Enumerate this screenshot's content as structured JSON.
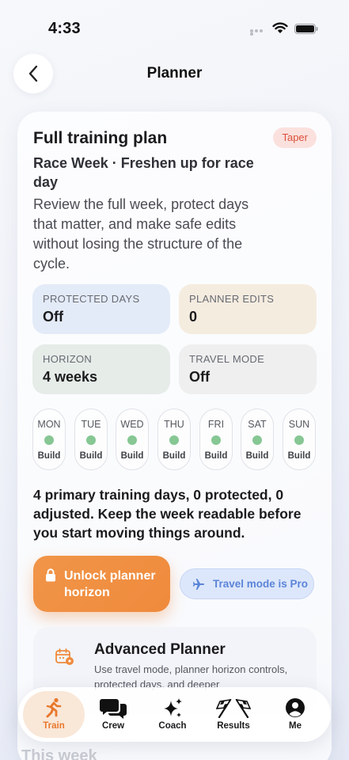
{
  "status_bar": {
    "time": "4:33"
  },
  "header": {
    "title": "Planner"
  },
  "plan": {
    "title": "Full training plan",
    "badge": "Taper",
    "subtitle": "Race Week · Freshen up for race day",
    "description": "Review the full week, protect days that matter, and make safe edits without losing the structure of the cycle."
  },
  "stats": [
    {
      "label": "PROTECTED DAYS",
      "value": "Off",
      "color": "#e4ebf8"
    },
    {
      "label": "PLANNER EDITS",
      "value": "0",
      "color": "#f5ece0"
    },
    {
      "label": "HORIZON",
      "value": "4 weeks",
      "color": "#e6ece8"
    },
    {
      "label": "TRAVEL MODE",
      "value": "Off",
      "color": "#efefef"
    }
  ],
  "days": [
    {
      "name": "MON",
      "tag": "Build"
    },
    {
      "name": "TUE",
      "tag": "Build"
    },
    {
      "name": "WED",
      "tag": "Build"
    },
    {
      "name": "THU",
      "tag": "Build"
    },
    {
      "name": "FRI",
      "tag": "Build"
    },
    {
      "name": "SAT",
      "tag": "Build"
    },
    {
      "name": "SUN",
      "tag": "Build"
    }
  ],
  "summary": "4 primary training days, 0 protected, 0 adjusted. Keep the week readable before you start moving things around.",
  "actions": {
    "unlock_label": "Unlock planner horizon",
    "travel_label": "Travel mode is Pro"
  },
  "advanced": {
    "title": "Advanced Planner",
    "description": "Use travel mode, planner horizon controls, protected days, and deeper"
  },
  "next_section": "This week",
  "tabs": [
    {
      "label": "Train",
      "icon": "runner-icon",
      "active": true
    },
    {
      "label": "Crew",
      "icon": "chat-bubbles-icon",
      "active": false
    },
    {
      "label": "Coach",
      "icon": "sparkles-icon",
      "active": false
    },
    {
      "label": "Results",
      "icon": "checkered-flags-icon",
      "active": false
    },
    {
      "label": "Me",
      "icon": "person-icon",
      "active": false
    }
  ],
  "colors": {
    "accent": "#ef8a3c",
    "badge": "#d9503a",
    "day_dot": "#86c794",
    "pro_blue": "#5b84d8"
  }
}
